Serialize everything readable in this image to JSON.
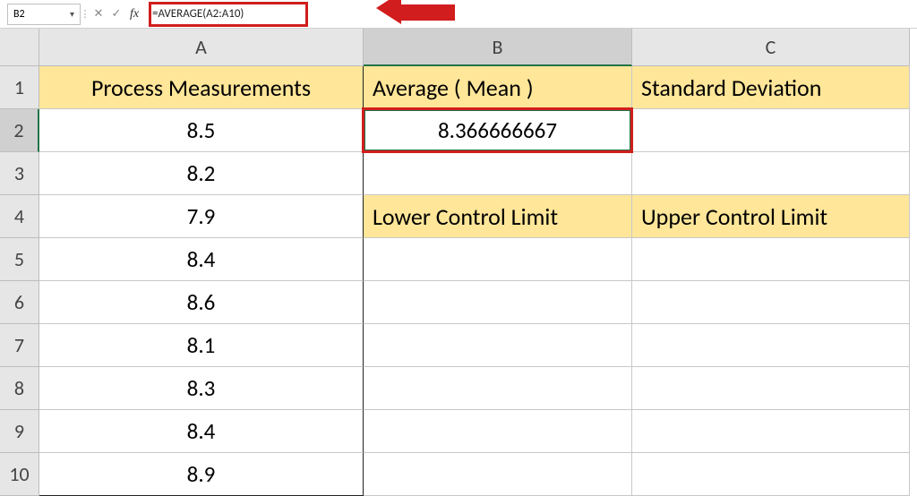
{
  "formula_bar": {
    "cell_ref": "B2",
    "formula": "=AVERAGE(A2:A10)"
  },
  "columns": [
    "A",
    "B",
    "C"
  ],
  "rows": [
    "1",
    "2",
    "3",
    "4",
    "5",
    "6",
    "7",
    "8",
    "9",
    "10"
  ],
  "headers": {
    "A1": "Process Measurements",
    "B1": "Average ( Mean )",
    "C1": "Standard Deviation",
    "B4": "Lower Control Limit",
    "C4": "Upper Control Limit"
  },
  "data": {
    "A2": "8.5",
    "A3": "8.2",
    "A4": "7.9",
    "A5": "8.4",
    "A6": "8.6",
    "A7": "8.1",
    "A8": "8.3",
    "A9": "8.4",
    "A10": "8.9",
    "B2": "8.366666667"
  }
}
